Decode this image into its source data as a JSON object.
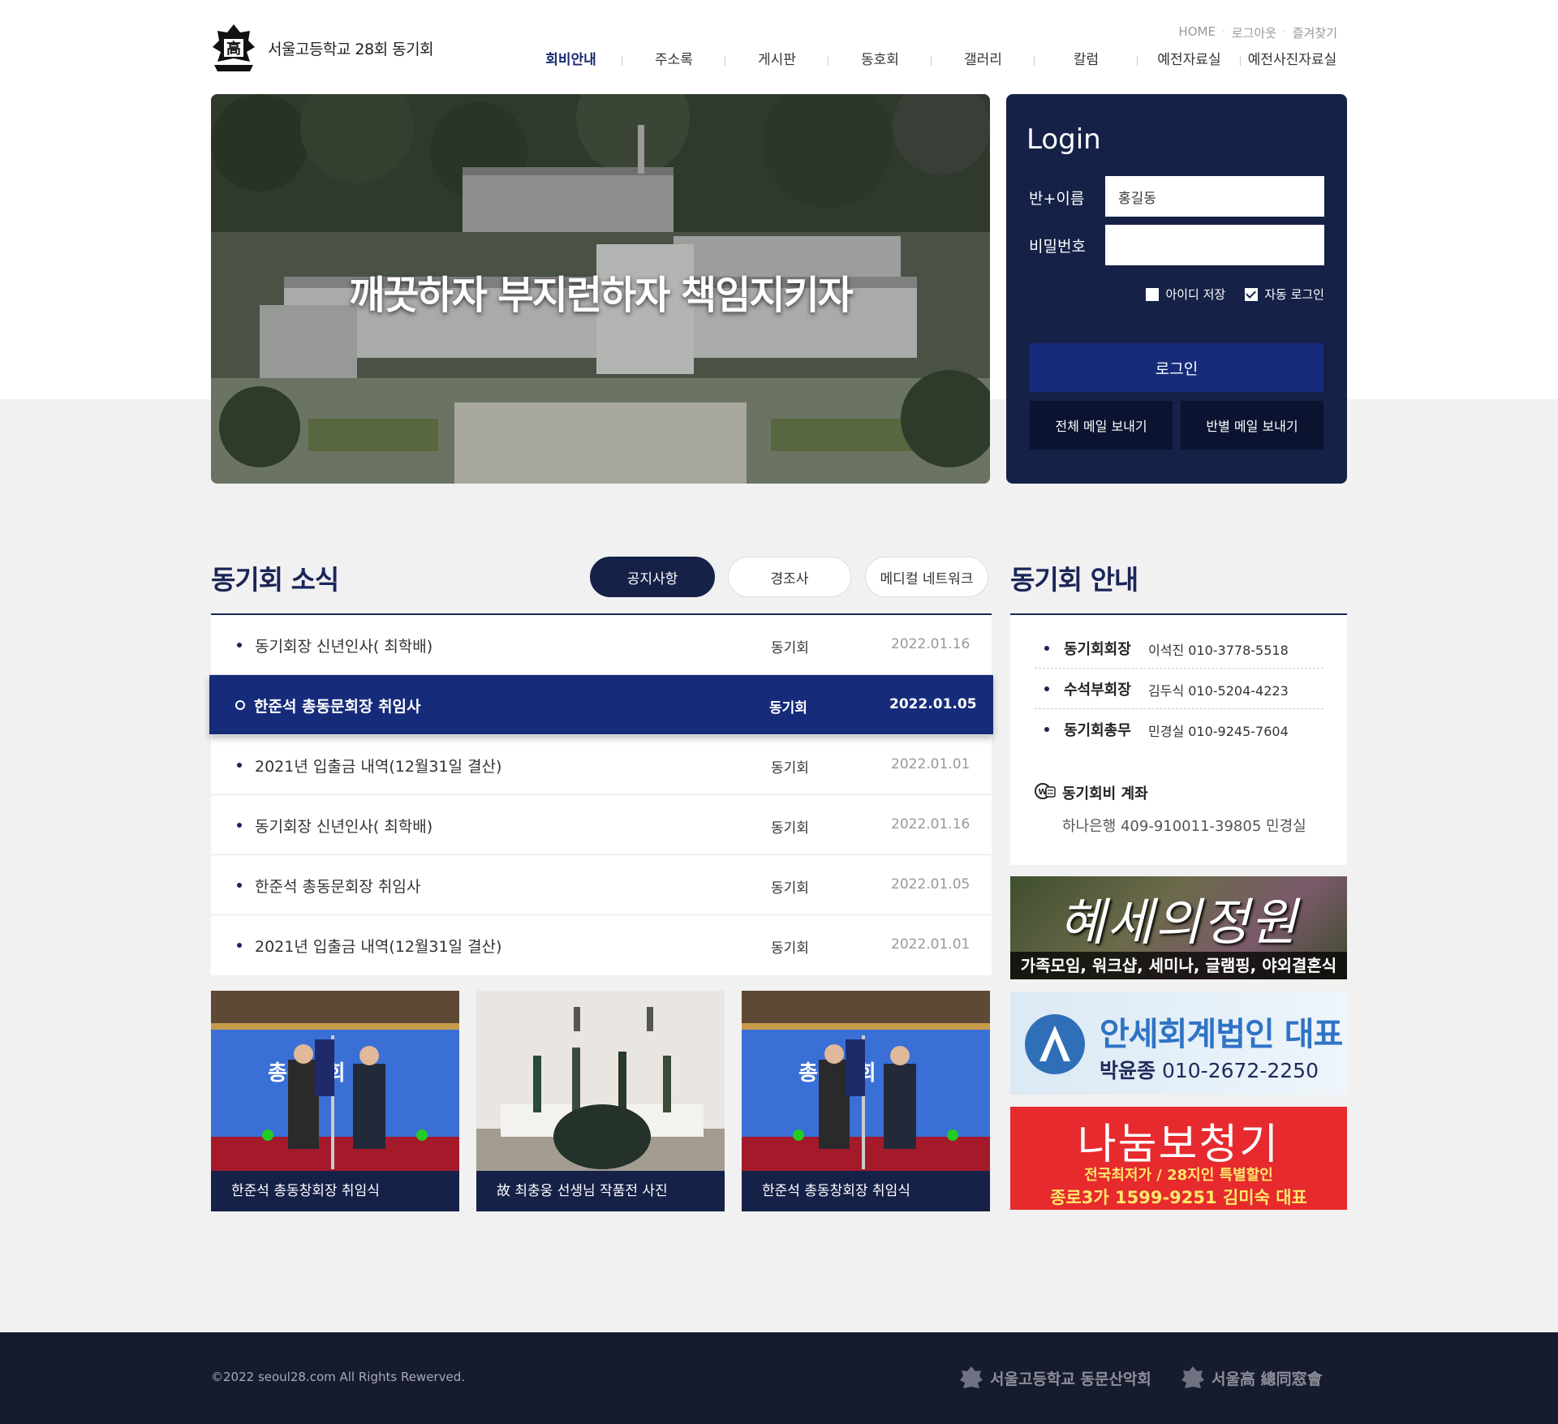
{
  "header": {
    "school_name": "서울고등학교  28회 동기회",
    "util": [
      "HOME",
      "로그아웃",
      "즐겨찾기"
    ],
    "nav": [
      "회비안내",
      "주소록",
      "게시판",
      "동호회",
      "갤러리",
      "칼럼",
      "예전자료실",
      "예전사진자료실"
    ],
    "nav_active_index": 0
  },
  "hero": {
    "slogan": "깨끗하자 부지런하자 책임지키자"
  },
  "login": {
    "title": "Login",
    "name_label": "반+이름",
    "name_value": "홍길동",
    "password_label": "비밀번호",
    "password_value": "",
    "save_id_label": "아이디 저장",
    "save_id_checked": false,
    "auto_login_label": "자동 로그인",
    "auto_login_checked": true,
    "login_button": "로그인",
    "mail_all_button": "전체 메일 보내기",
    "mail_class_button": "반별 메일 보내기"
  },
  "news": {
    "title": "동기회 소식",
    "tabs": [
      "공지사항",
      "경조사",
      "메디컬 네트워크"
    ],
    "active_tab": 0,
    "items": [
      {
        "title": "동기회장 신년인사( 최학배)",
        "category": "동기회",
        "date": "2022.01.16"
      },
      {
        "title": "한준석 총동문회장 취임사",
        "category": "동기회",
        "date": "2022.01.05"
      },
      {
        "title": "2021년 입출금 내역(12월31일 결산)",
        "category": "동기회",
        "date": "2022.01.01"
      },
      {
        "title": "동기회장 신년인사( 최학배)",
        "category": "동기회",
        "date": "2022.01.16"
      },
      {
        "title": "한준석 총동문회장 취임사",
        "category": "동기회",
        "date": "2022.01.05"
      },
      {
        "title": "2021년 입출금 내역(12월31일 결산)",
        "category": "동기회",
        "date": "2022.01.01"
      }
    ],
    "highlighted_index": 1
  },
  "gallery": [
    {
      "caption": "한준석 총동창회장 취임식"
    },
    {
      "caption": "故 최충웅 선생님 작품전 사진"
    },
    {
      "caption": "한준석 총동창회장 취임식"
    }
  ],
  "info": {
    "title": "동기회 안내",
    "officers": [
      {
        "role": "동기회회장",
        "value": "이석진 010-3778-5518"
      },
      {
        "role": "수석부회장",
        "value": "김두식 010-5204-4223"
      },
      {
        "role": "동기회총무",
        "value": "민경실 010-9245-7604"
      }
    ],
    "account_label": "동기회비 계좌",
    "account_value": "하나은행 409-910011-39805 민경실"
  },
  "banners": {
    "b1_main": "혜세의정원",
    "b1_sub": "가족모임, 워크샵, 세미나, 글램핑, 야외결혼식",
    "b2_main": "안세회계법인 대표",
    "b2_name": "박윤종",
    "b2_phone": "010-2672-2250",
    "b3_main": "나눔보청기",
    "b3_sub1": "전국최저가 / 28지인 특별할인",
    "b3_sub2": "종로3가 1599-9251 김미숙 대표"
  },
  "footer": {
    "copyright": "©2022 seoul28.com All Rights Rewerved.",
    "logo1": "서울고등학교 동문산악회",
    "logo2": "서울高 總同窓會"
  },
  "colors": {
    "navy": "#162148",
    "blue": "#162b7a",
    "footer": "#161b2e"
  }
}
